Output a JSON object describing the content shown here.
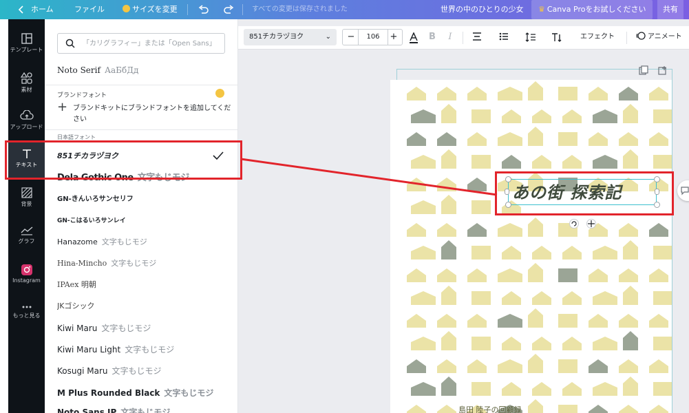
{
  "topbar": {
    "home": "ホーム",
    "file": "ファイル",
    "resize": "サイズを変更",
    "saved": "すべての変更は保存されました",
    "doc_title": "世界の中のひとりの少女",
    "pro": "Canva Proをお試しください",
    "share": "共有"
  },
  "rail": {
    "items": [
      {
        "label": "テンプレート"
      },
      {
        "label": "素材"
      },
      {
        "label": "アップロード"
      },
      {
        "label": "テキスト"
      },
      {
        "label": "背景"
      },
      {
        "label": "グラフ"
      },
      {
        "label": "Instagram"
      },
      {
        "label": "もっと見る"
      }
    ]
  },
  "panel": {
    "search_placeholder": "「カリグラフィー」または「Open Sans」",
    "top_font": {
      "name": "Noto Serif",
      "sample": "АаБбДд"
    },
    "brand_title": "ブランドフォント",
    "brand_add": "ブランドキットにブランドフォントを追加してください",
    "jp_title": "日本語フォント",
    "fonts": [
      {
        "name": "851チカラヅヨク",
        "sample": ""
      },
      {
        "name": "Dela Gothic One",
        "sample": "文字もじモジ"
      },
      {
        "name": "GN-きんいろサンセリフ",
        "sample": ""
      },
      {
        "name": "GN-こはるいろサンレイ",
        "sample": ""
      },
      {
        "name": "Hanazome",
        "sample": "文字もじモジ"
      },
      {
        "name": "Hina-Mincho",
        "sample": "文字もじモジ"
      },
      {
        "name": "IPAex 明朝",
        "sample": ""
      },
      {
        "name": "JKゴシック",
        "sample": ""
      },
      {
        "name": "Kiwi Maru",
        "sample": "文字もじモジ"
      },
      {
        "name": "Kiwi Maru Light",
        "sample": "文字もじモジ"
      },
      {
        "name": "Kosugi Maru",
        "sample": "文字もじモジ"
      },
      {
        "name": "M Plus Rounded Black",
        "sample": "文字もじモジ"
      },
      {
        "name": "Noto Sans JP",
        "sample": "文字もじモジ"
      }
    ]
  },
  "toolbar": {
    "font": "851チカラヅヨク",
    "size": "106",
    "minus": "−",
    "plus": "+",
    "effect": "エフェクト",
    "animate": "アニメート"
  },
  "canvas": {
    "title": "あの街 探索記",
    "subtitle": "島田 陸子の回顧録"
  },
  "colors": {
    "house_yellow": "#ebe3a7",
    "house_gray": "#9ba596",
    "accent_red": "#e2242b",
    "selection": "#3dc0cf"
  }
}
